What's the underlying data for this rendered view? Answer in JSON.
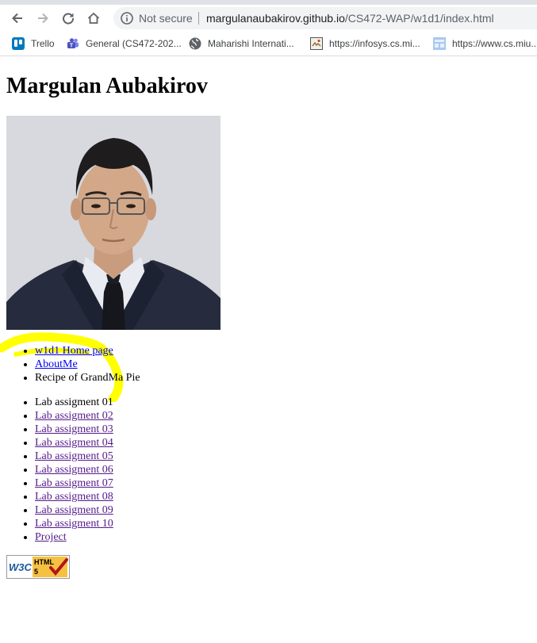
{
  "browser": {
    "security_label": "Not secure",
    "url_host": "margulanaubakirov.github.io",
    "url_path": "/CS472-WAP/w1d1/index.html",
    "bookmarks": [
      {
        "label": "Trello",
        "icon": "trello-icon"
      },
      {
        "label": "General (CS472-202...",
        "icon": "teams-icon"
      },
      {
        "label": "Maharishi Internati...",
        "icon": "globe-icon"
      },
      {
        "label": "https://infosys.cs.mi...",
        "icon": "page-thumbnail-icon"
      },
      {
        "label": "https://www.cs.miu...",
        "icon": "page-thumbnail-icon"
      }
    ]
  },
  "page": {
    "title": "Margulan Aubakirov",
    "nav_links": [
      "w1d1 Home page",
      "AboutMe"
    ],
    "recipe_text": "Recipe of GrandMa Pie",
    "lab_current": "Lab assigment 01",
    "lab_links": [
      "Lab assigment 02",
      "Lab assigment 03",
      "Lab assigment 04",
      "Lab assigment 05",
      "Lab assigment 06",
      "Lab assigment 07",
      "Lab assigment 08",
      "Lab assigment 09",
      "Lab assigment 10"
    ],
    "project_link": "Project"
  },
  "badge": {
    "line1": "W3C",
    "line2": "HTML",
    "line3": "5"
  },
  "colors": {
    "link": "#0000ee",
    "visited": "#551a8b",
    "highlight": "#ffff00"
  }
}
